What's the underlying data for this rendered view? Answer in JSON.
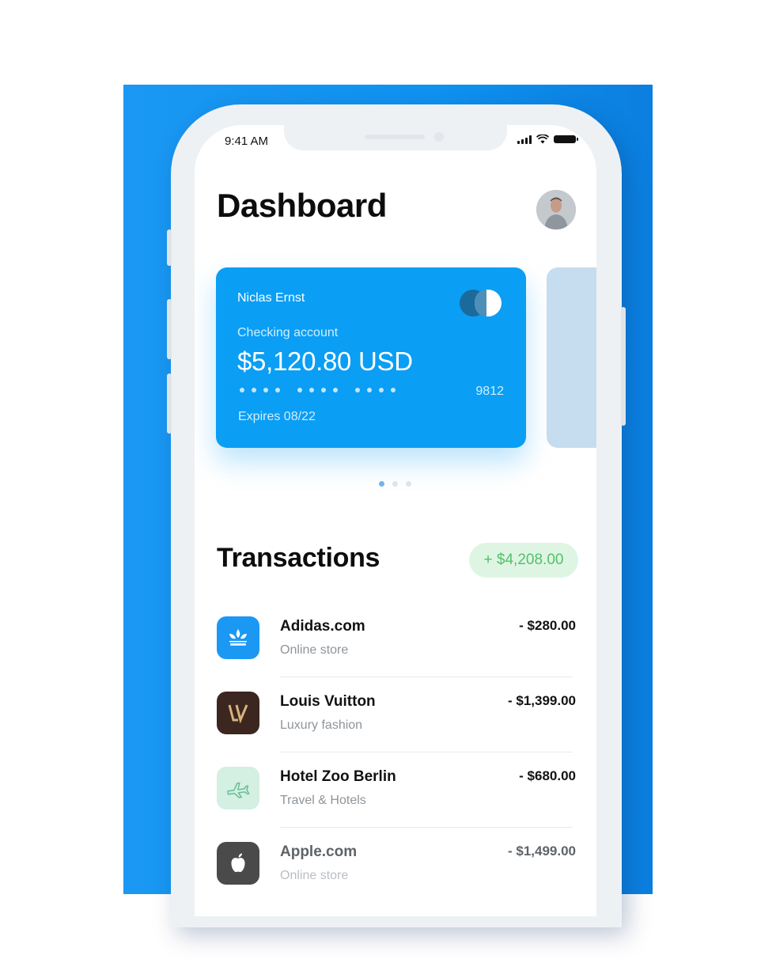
{
  "status_bar": {
    "time": "9:41 AM"
  },
  "header": {
    "title": "Dashboard"
  },
  "card": {
    "holder": "Niclas Ernst",
    "account_type": "Checking account",
    "balance": "$5,120.80 USD",
    "last4": "9812",
    "expires": "Expires 08/22"
  },
  "pager": {
    "pages": 3,
    "active": 1
  },
  "transactions": {
    "title": "Transactions",
    "total": "+ $4,208.00",
    "items": [
      {
        "name": "Adidas.com",
        "category": "Online store",
        "amount": "- $280.00",
        "icon": "adidas-logo-icon",
        "color": "#1a98f3"
      },
      {
        "name": "Louis Vuitton",
        "category": "Luxury fashion",
        "amount": "- $1,399.00",
        "icon": "louis-vuitton-logo-icon",
        "color": "#3b2620"
      },
      {
        "name": "Hotel Zoo Berlin",
        "category": "Travel & Hotels",
        "amount": "- $680.00",
        "icon": "airplane-icon",
        "color": "#d3f0e2"
      },
      {
        "name": "Apple.com",
        "category": "Online store",
        "amount": "- $1,499.00",
        "icon": "apple-logo-icon",
        "color": "#4a4a4a"
      }
    ]
  },
  "colors": {
    "accent": "#0a9ef5",
    "background_panel": "#1a98f3",
    "positive": "#52c16a"
  }
}
